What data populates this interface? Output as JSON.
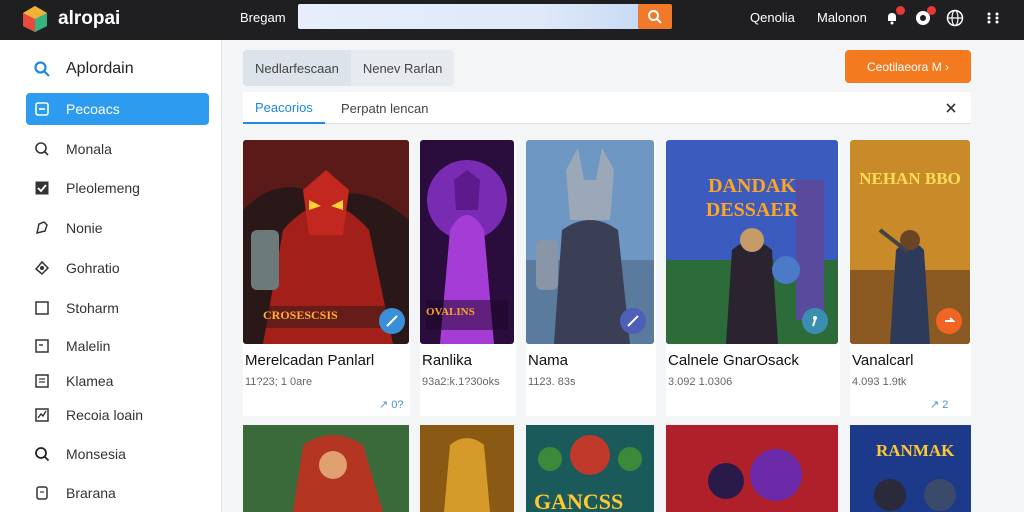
{
  "topbar": {
    "app_name": "alropai",
    "browse_label": "Bregam",
    "link_1": "Qenolia",
    "link_2": "Malonon"
  },
  "sidebar": {
    "items": [
      {
        "label": "Aplordain",
        "icon": "search-icon"
      },
      {
        "label": "Pecoacs",
        "icon": "square-icon"
      },
      {
        "label": "Monala",
        "icon": "search-circle-icon"
      },
      {
        "label": "Pleolemeng",
        "icon": "check-box-icon"
      },
      {
        "label": "Nonie",
        "icon": "puzzle-icon"
      },
      {
        "label": "Gohratio",
        "icon": "gear-shape-icon"
      },
      {
        "label": "Stoharm",
        "icon": "square-outline-icon"
      },
      {
        "label": "Malelin",
        "icon": "document-icon"
      },
      {
        "label": "Klamea",
        "icon": "document-lines-icon"
      },
      {
        "label": "Recoia loain",
        "icon": "chart-icon"
      },
      {
        "label": "Monsesia",
        "icon": "search-icon"
      },
      {
        "label": "Brarana",
        "icon": "clipboard-icon"
      }
    ]
  },
  "filters": {
    "chips": [
      "Nedlarfescaan",
      "Nenev Rarlan"
    ],
    "cta_label": "Ceotilaeora M ›"
  },
  "tabs": [
    "Peacorios",
    "Perpatn lencan"
  ],
  "cards": [
    {
      "title": "Merelcadan Panlarl",
      "meta": "11?23; 1 0are",
      "art_text": "CROSESCSIS",
      "share": "↗ 0?"
    },
    {
      "title": "Ranlika",
      "meta": "93a2:k.1?30oks",
      "art_text": "OVALINS",
      "share": ""
    },
    {
      "title": "Nama",
      "meta": "1123. 83s",
      "art_text": "",
      "share": ""
    },
    {
      "title": "Calnele GnarOsack",
      "meta": "3.092 1.0306",
      "art_text": "DANDAK DESSAER",
      "share": ""
    },
    {
      "title": "Vanalcarl",
      "meta": "4.093 1.9tk",
      "art_text": "NEHAN BBO",
      "share": "↗ 2"
    }
  ],
  "row2_cards": [
    {
      "art_text": ""
    },
    {
      "art_text": ""
    },
    {
      "art_text": "GANCSS"
    },
    {
      "art_text": ""
    },
    {
      "art_text": "RANMAK"
    }
  ],
  "colors": {
    "accent": "#2d9cf0",
    "cta": "#f47a20",
    "topbar": "#1f1f22"
  }
}
